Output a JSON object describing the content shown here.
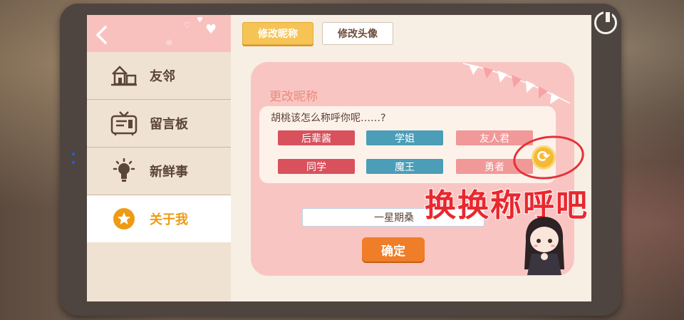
{
  "sidebar": {
    "items": [
      {
        "label": "友邻",
        "icon": "house-icon"
      },
      {
        "label": "留言板",
        "icon": "message-board-icon"
      },
      {
        "label": "新鲜事",
        "icon": "lightbulb-icon"
      },
      {
        "label": "关于我",
        "icon": "star-icon"
      }
    ]
  },
  "tabs": [
    {
      "label": "修改昵称",
      "active": true
    },
    {
      "label": "修改头像",
      "active": false
    }
  ],
  "card": {
    "title": "更改昵称",
    "question": "胡桃该怎么称呼你呢……?"
  },
  "nickname_options": [
    {
      "label": "后辈酱",
      "color": "#d9515d"
    },
    {
      "label": "学姐",
      "color": "#4b9db8"
    },
    {
      "label": "友人君",
      "color": "#f19898"
    },
    {
      "label": "同学",
      "color": "#d9515d"
    },
    {
      "label": "魔王",
      "color": "#4b9db8"
    },
    {
      "label": "勇者",
      "color": "#f19898"
    }
  ],
  "name_input": {
    "value": "一星期桑"
  },
  "confirm_label": "确定",
  "annotation": {
    "text": "换换称呼吧",
    "color": "#e8282f"
  },
  "colors": {
    "accent": "#ee9b14",
    "card_bg": "#f9c5c3",
    "confirm": "#f07d27"
  }
}
